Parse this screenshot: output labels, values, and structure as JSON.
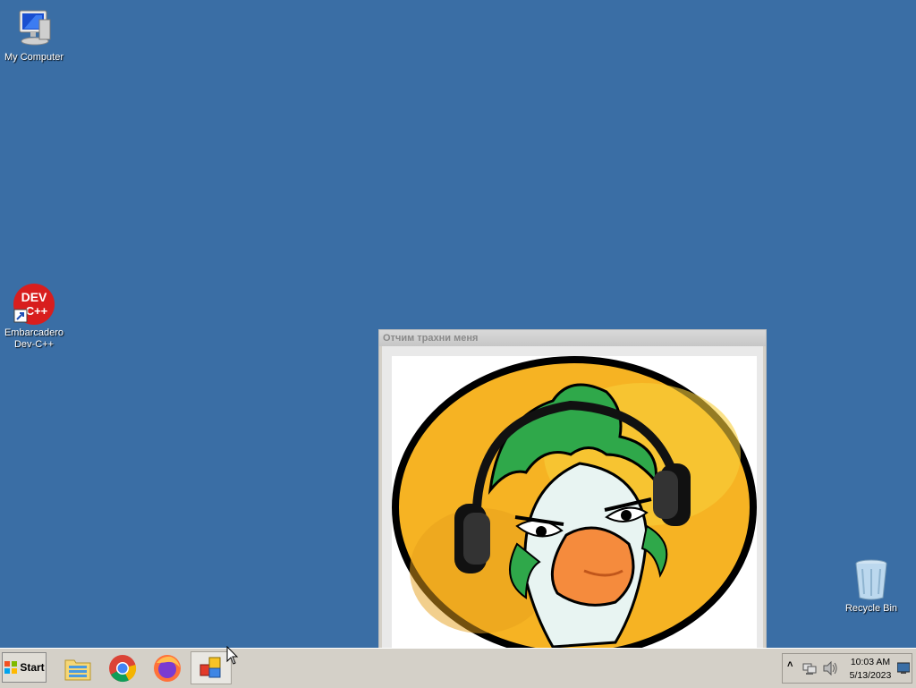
{
  "desktop": {
    "background_color": "#3a6ea5",
    "icons": [
      {
        "label": "My Computer",
        "icon": "computer-icon"
      },
      {
        "label": "Embarcadero Dev-C++",
        "icon": "devcpp-icon",
        "icon_text_top": "DEV",
        "icon_text_bottom": "C++"
      },
      {
        "label": "Recycle Bin",
        "icon": "recycle-bin-icon"
      }
    ]
  },
  "window": {
    "title": "Отчим трахни меня",
    "content": "goose-with-headphones-image"
  },
  "taskbar": {
    "start_label": "Start",
    "pinned": [
      {
        "name": "file-explorer",
        "icon": "folder-icon"
      },
      {
        "name": "chrome",
        "icon": "chrome-icon"
      },
      {
        "name": "firefox",
        "icon": "firefox-icon"
      },
      {
        "name": "app-window",
        "icon": "app-window-icon",
        "active": true
      }
    ],
    "tray": {
      "time": "10:03 AM",
      "date": "5/13/2023",
      "icons": [
        "show-hidden-icon",
        "network-icon",
        "volume-icon",
        "show-desktop-icon"
      ]
    }
  }
}
